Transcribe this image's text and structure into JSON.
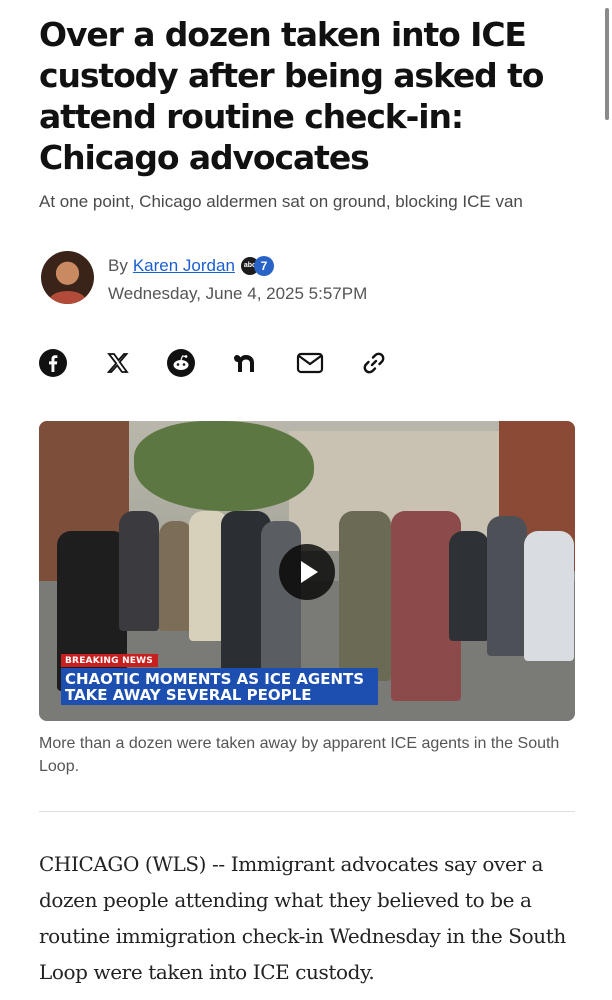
{
  "article": {
    "headline": "Over a dozen taken into ICE custody after being asked to attend routine check-in: Chicago advocates",
    "subheadline": "At one point, Chicago aldermen sat on ground, blocking ICE van"
  },
  "byline": {
    "by": "By",
    "author": "Karen Jordan",
    "outlet_logo": {
      "left": "abc",
      "right": "7"
    },
    "date": "Wednesday, June 4, 2025 5:57PM"
  },
  "share": {
    "icons": [
      "facebook-icon",
      "x-icon",
      "reddit-icon",
      "nextdoor-icon",
      "email-icon",
      "link-icon"
    ]
  },
  "video": {
    "breaking_label": "BREAKING NEWS",
    "banner_line1": "CHAOTIC MOMENTS AS ICE AGENTS",
    "banner_line2": "TAKE AWAY SEVERAL PEOPLE",
    "caption": "More than a dozen were taken away by apparent ICE agents in the South Loop."
  },
  "body": {
    "paragraph1": "CHICAGO (WLS) -- Immigrant advocates say over a dozen people attending what they believed to be a routine immigration check-in Wednesday in the South Loop were taken into ICE custody."
  },
  "colors": {
    "link": "#1a5fd3",
    "breaking": "#c8201f",
    "banner": "#1d4fb0"
  }
}
